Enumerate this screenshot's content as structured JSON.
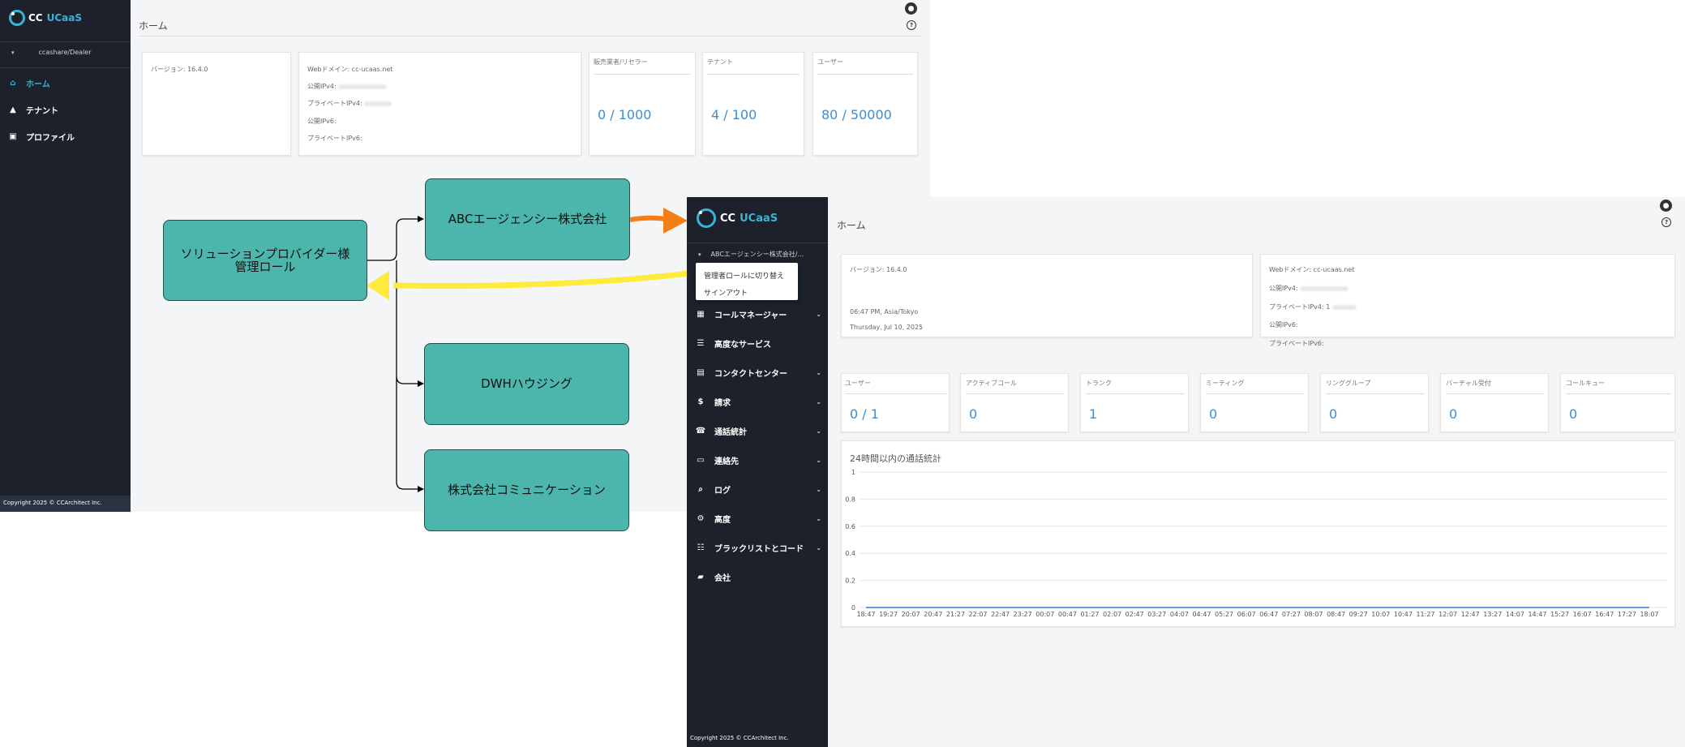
{
  "app1": {
    "brand": {
      "cc": "CC",
      "ucaas": "UCaaS"
    },
    "tenant": "ccashare/Dealer",
    "nav": [
      {
        "label": "ホーム",
        "icon": "home-icon",
        "active": true
      },
      {
        "label": "テナント",
        "icon": "tenant-icon",
        "active": false
      },
      {
        "label": "プロファイル",
        "icon": "profile-icon",
        "active": false
      }
    ],
    "copyright": "Copyright 2025 © CCArchitect Inc.",
    "page_title": "ホーム",
    "version": "バージョン: 16.4.0",
    "info": {
      "web_domain": "Webドメイン: cc-ucaas.net",
      "public_ipv4": "公開IPv4:",
      "private_ipv4": "プライベートIPv4:",
      "public_ipv6": "公開IPv6:",
      "private_ipv6": "プライベートIPv6:"
    },
    "stats": [
      {
        "label": "販売業者/リセラー",
        "value": "0 / 1000"
      },
      {
        "label": "テナント",
        "value": "4 / 100"
      },
      {
        "label": "ユーザー",
        "value": "80 / 50000"
      }
    ]
  },
  "diagram": {
    "provider": "ソリューションプロバイダー様\n管理ロール",
    "agency": "ABCエージェンシー株式会社",
    "dwh": "DWHハウジング",
    "comm": "株式会社コミュニケーション",
    "colors": {
      "box": "#4db6ac",
      "orange_arrow": "#f57f17",
      "yellow_arrow": "#ffeb3b"
    }
  },
  "app2": {
    "brand": {
      "cc": "CC",
      "ucaas": "UCaaS"
    },
    "tenant": "ABCエージェンシー株式会社/...",
    "popup": [
      "管理者ロールに切り替え",
      "サインアウト"
    ],
    "menu": [
      {
        "label": "コールマネージャー",
        "icon": "qr-grid-icon",
        "chevron": true
      },
      {
        "label": "高度なサービス",
        "icon": "list-icon",
        "chevron": false
      },
      {
        "label": "コンタクトセンター",
        "icon": "clipboard-icon",
        "chevron": true
      },
      {
        "label": "請求",
        "icon": "dollar-icon",
        "chevron": true
      },
      {
        "label": "通話統計",
        "icon": "phone-icon",
        "chevron": true
      },
      {
        "label": "連絡先",
        "icon": "contact-card-icon",
        "chevron": true
      },
      {
        "label": "ログ",
        "icon": "log-search-icon",
        "chevron": true
      },
      {
        "label": "高度",
        "icon": "gear-icon",
        "chevron": true
      },
      {
        "label": "ブラックリストとコード",
        "icon": "blacklist-icon",
        "chevron": true
      },
      {
        "label": "会社",
        "icon": "briefcase-icon",
        "chevron": false
      }
    ],
    "copyright": "Copyright 2025 © CCArchitect Inc.",
    "page_title": "ホーム",
    "version": "バージョン: 16.4.0",
    "time": "06:47 PM, Asia/Tokyo",
    "date": "Thursday, Jul 10, 2025",
    "info": {
      "web_domain": "Webドメイン: cc-ucaas.net",
      "public_ipv4": "公開IPv4:",
      "private_ipv4": "プライベートIPv4: 1",
      "public_ipv6": "公開IPv6:",
      "private_ipv6": "プライベートIPv6:"
    },
    "stats": [
      {
        "label": "ユーザー",
        "value": "0 / 1"
      },
      {
        "label": "アクティブコール",
        "value": "0"
      },
      {
        "label": "トランク",
        "value": "1"
      },
      {
        "label": "ミーティング",
        "value": "0"
      },
      {
        "label": "リンググループ",
        "value": "0"
      },
      {
        "label": "バーチャル受付",
        "value": "0"
      },
      {
        "label": "コールキュー",
        "value": "0"
      }
    ]
  },
  "chart_data": {
    "type": "line",
    "title": "24時間以内の通話統計",
    "x": [
      "18:47",
      "19:27",
      "20:07",
      "20:47",
      "21:27",
      "22:07",
      "22:47",
      "23:27",
      "00:07",
      "00:47",
      "01:27",
      "02:07",
      "02:47",
      "03:27",
      "04:07",
      "04:47",
      "05:27",
      "06:07",
      "06:47",
      "07:27",
      "08:07",
      "08:47",
      "09:27",
      "10:07",
      "10:47",
      "11:27",
      "12:07",
      "12:47",
      "13:27",
      "14:07",
      "14:47",
      "15:27",
      "16:07",
      "16:47",
      "17:27",
      "18:07"
    ],
    "series": [
      {
        "values": [
          0,
          0,
          0,
          0,
          0,
          0,
          0,
          0,
          0,
          0,
          0,
          0,
          0,
          0,
          0,
          0,
          0,
          0,
          0,
          0,
          0,
          0,
          0,
          0,
          0,
          0,
          0,
          0,
          0,
          0,
          0,
          0,
          0,
          0,
          0,
          0
        ]
      }
    ],
    "ylim": [
      0,
      1
    ],
    "yticks": [
      "1",
      "0.8",
      "0.6",
      "0.4",
      "0.2",
      "0"
    ],
    "grid": true,
    "line_color": "#2f7fd1"
  }
}
